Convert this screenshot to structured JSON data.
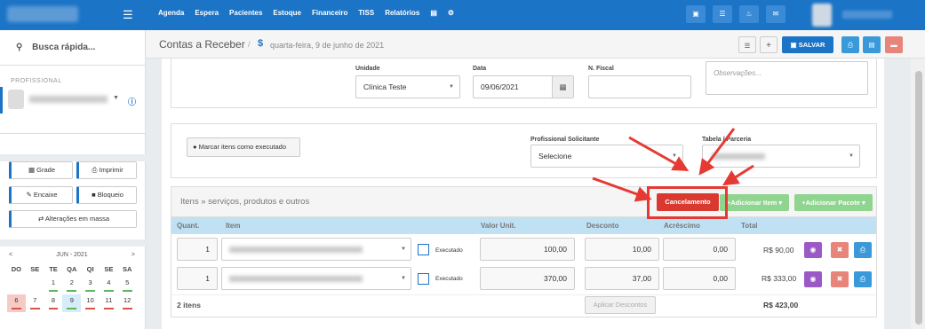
{
  "topbar": {
    "menu": [
      "Agenda",
      "Espera",
      "Pacientes",
      "Estoque",
      "Financeiro",
      "TISS",
      "Relatórios"
    ],
    "icons": [
      "inbox-icon",
      "list-icon",
      "bell-icon",
      "chat-icon"
    ]
  },
  "sidebar": {
    "search": "Busca rápida...",
    "professional_label": "PROFISSIONAL",
    "buttons": {
      "grade": "Grade",
      "imprimir": "Imprimir",
      "encaixe": "Encaixe",
      "bloqueio": "Bloqueio",
      "alteracoes": "Alterações em massa"
    },
    "calendar": {
      "month": "JUN - 2021",
      "prev": "<",
      "next": ">",
      "weekdays": [
        "DO",
        "SE",
        "TE",
        "QA",
        "QI",
        "SE",
        "SA"
      ],
      "week1": [
        "",
        "",
        "1",
        "2",
        "3",
        "4",
        "5"
      ],
      "week2": [
        "6",
        "7",
        "8",
        "9",
        "10",
        "11",
        "12"
      ],
      "selected_day": "9",
      "holiday_day": "6"
    }
  },
  "header": {
    "title": "Contas a Receber",
    "separator": "/",
    "dollar": "$",
    "date": "quarta-feira, 9 de junho de 2021",
    "save": "SALVAR"
  },
  "form": {
    "unidade_label": "Unidade",
    "unidade_value": "Clínica Teste",
    "data_label": "Data",
    "data_value": "09/06/2021",
    "nfiscal_label": "N. Fiscal",
    "nfiscal_value": "",
    "obs_placeholder": "Observações...",
    "mark_executed": "Marcar itens como executado",
    "prof_sol_label": "Profissional Solicitante",
    "prof_sol_value": "Selecione",
    "tabela_label": "Tabela / Parceria"
  },
  "items": {
    "title": "Itens » serviços, produtos e outros",
    "cancel": "Cancelamento",
    "add_item": "Adicionar Item",
    "add_pacote": "Adicionar Pacote",
    "headers": {
      "qty": "Quant.",
      "item": "Item",
      "unit": "Valor Unit.",
      "discount": "Desconto",
      "add": "Acréscimo",
      "total": "Total"
    },
    "rows": [
      {
        "qty": "1",
        "executed": "Executado",
        "unit": "100,00",
        "discount": "10,00",
        "add": "0,00",
        "total": "R$ 90,00"
      },
      {
        "qty": "1",
        "executed": "Executado",
        "unit": "370,00",
        "discount": "37,00",
        "add": "0,00",
        "total": "R$ 333,00"
      }
    ],
    "count": "2 itens",
    "apply_discounts": "Aplicar Descontos",
    "grand_total": "R$ 423,00"
  },
  "colors": {
    "primary": "#1b74c6",
    "danger": "#d9392e",
    "success": "#8fd48f",
    "annotation": "#e53a33"
  }
}
